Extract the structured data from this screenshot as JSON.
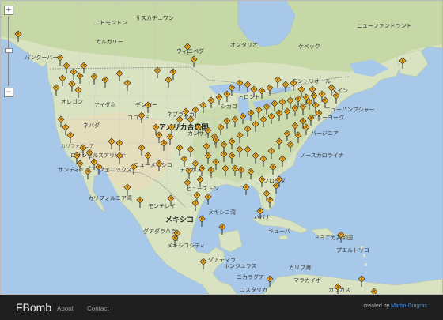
{
  "app": {
    "brand": "FBomb",
    "nav": [
      "About",
      "Contact"
    ],
    "credit_prefix": "created by",
    "credit_author": "Martin Gingras"
  },
  "colors": {
    "water": "#a7c8e8",
    "land": "#dfe6c9",
    "forest": "#b7cf93",
    "desert": "#e8dfc2",
    "marker": "#f3a815",
    "marker_outline": "#333333",
    "footer": "#1f1f1f",
    "link": "#3a8ee6"
  },
  "map": {
    "zoom_in": "+",
    "zoom_out": "−",
    "marker_icon": "warning-pin-icon",
    "labels": {
      "usa": "アメリカ合衆国",
      "mexico": "メキシコ",
      "edmonton": "エドモントン",
      "saskatchewan": "サスカチュワン",
      "calgary": "カルガリー",
      "vancouver": "バンクーバー",
      "winnipeg": "ウィニペグ",
      "ontario": "オンタリオ",
      "quebec": "ケベック",
      "newfoundland": "ニューファンドランド",
      "montreal": "モントリオール",
      "denver": "デンバー",
      "oregon": "オレゴン",
      "idaho": "アイダホ",
      "nevada": "ネバダ",
      "arizona": "アリゾナ",
      "phoenix": "フェニックス",
      "san_diego": "サンディエゴ",
      "los_angeles": "ロサンゼルス",
      "california": "カリフォルニア",
      "colorado": "コロラド",
      "kansas": "カンザス",
      "nebraska": "ネブラスカ",
      "houston": "ヒューストン",
      "new_mexico": "ニューメキシコ",
      "texas": "テキサス",
      "monterrey": "モンテレイ",
      "guadalajara": "グアダラハラ",
      "mexico_city": "メキシコシティ",
      "gulf": "メキシコ湾",
      "havana": "ハバナ",
      "cuba": "キューバ",
      "dominican": "ドミニカ共和国",
      "puerto_rico": "プエルトリコ",
      "guatemala": "グアテマラ",
      "honduras": "ホンジュラス",
      "nicaragua": "ニカラグア",
      "costa_rica": "コスタリカ",
      "caribbean": "カリブ海",
      "maracaibo": "マラカイボ",
      "caracas": "カラカス",
      "toronto": "トロント",
      "chicago": "シカゴ",
      "new_york": "ニューヨーク",
      "maine": "メイン",
      "new_hampshire": "ニューハンプシャー",
      "virginia": "バージニア",
      "north_carolina": "ノースカロライナ",
      "florida": "フロリダ",
      "baja": "カリフォルニア湾"
    }
  }
}
